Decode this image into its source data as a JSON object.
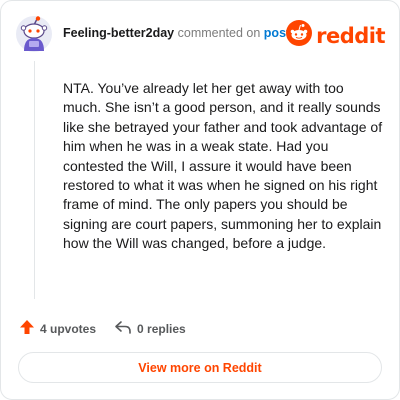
{
  "header": {
    "username": "Feeling-better2day",
    "commented_on": "commented on",
    "post_label": "post",
    "brand": "reddit"
  },
  "comment": {
    "text": "NTA. You’ve already let her get away with too much. She isn’t a good person, and it really sounds like she betrayed your father and took advantage of him when he was in a weak state. Had you contested the Will, I assure it would have been restored to what it was when he signed on his right frame of mind. The only papers you should be signing are court papers, summoning her to explain how the Will was changed, before a judge."
  },
  "actions": {
    "upvotes": "4 upvotes",
    "replies": "0 replies"
  },
  "footer": {
    "view_more": "View more on Reddit"
  },
  "colors": {
    "brand": "#ff4500",
    "link": "#0079d3",
    "upvote": "#ff4500"
  },
  "icons": {
    "avatar": "snoo-avatar-icon",
    "logo": "reddit-logo-icon",
    "upvote": "upvote-arrow-icon",
    "reply": "reply-arrow-icon"
  }
}
